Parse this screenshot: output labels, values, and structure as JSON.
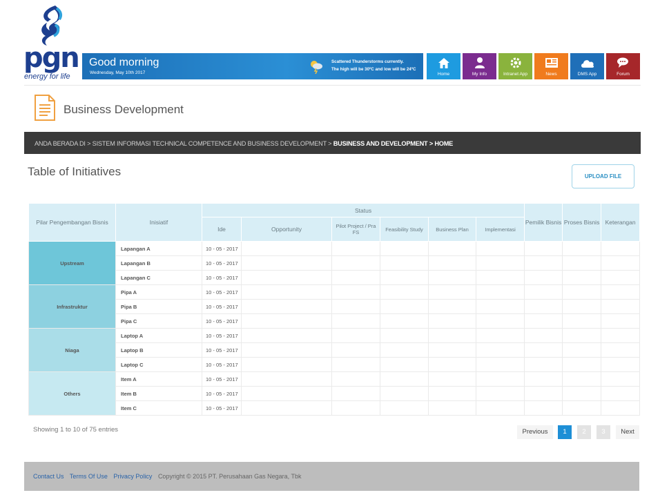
{
  "brand": {
    "wordmark": "pgn",
    "tagline": "energy for life"
  },
  "greeting": {
    "title": "Good morning",
    "date": "Wednesday, May 10th 2017",
    "weather_line1": "Scattered Thunderstorms currently.",
    "weather_line2": "The high will be 30ºC and low will be 24ºC"
  },
  "nav": [
    {
      "label": "Home",
      "color": "#1e9be0",
      "icon": "home-icon"
    },
    {
      "label": "My Info",
      "color": "#7b2c8f",
      "icon": "user-icon"
    },
    {
      "label": "Intranet App",
      "color": "#8ab33d",
      "icon": "gear-icon"
    },
    {
      "label": "News",
      "color": "#f07b1d",
      "icon": "news-icon"
    },
    {
      "label": "DMS App",
      "color": "#1f6fb8",
      "icon": "cloud-icon"
    },
    {
      "label": "Forum",
      "color": "#a6272a",
      "icon": "chat-icon"
    }
  ],
  "page_title": "Business Development",
  "breadcrumb": {
    "prefix": "ANDA BERADA DI > SISTEM INFORMASI TECHNICAL COMPETENCE AND BUSINESS DEVELOPMENT > ",
    "current": "BUSINESS AND DEVELOPMENT > HOME"
  },
  "section_title": "Table of Initiatives",
  "upload_label": "UPLOAD FILE",
  "table": {
    "headers": {
      "pilar": "Pilar Pengembangan Bisnis",
      "inisiatif": "Inisiatif",
      "status": "Status",
      "ide": "Ide",
      "opportunity": "Opportunity",
      "pilot": "Pilot Project / Pra FS",
      "feasibility": "Feasibility Study",
      "business_plan": "Business Plan",
      "implementasi": "Implementasi",
      "pemilik": "Pemilik Bisnis",
      "proses": "Proses Bisnis",
      "keterangan": "Keterangan"
    },
    "groups": [
      {
        "pillar": "Upstream",
        "color": "#6ec6d9",
        "rows": [
          {
            "inisiatif": "Lapangan A",
            "ide": "10 - 05 - 2017"
          },
          {
            "inisiatif": "Lapangan B",
            "ide": "10 - 05 - 2017"
          },
          {
            "inisiatif": "Lapangan C",
            "ide": "10 - 05 - 2017"
          }
        ]
      },
      {
        "pillar": "Infrastruktur",
        "color": "#8dd1e0",
        "rows": [
          {
            "inisiatif": "Pipa A",
            "ide": "10 - 05 - 2017"
          },
          {
            "inisiatif": "Pipa B",
            "ide": "10 - 05 - 2017"
          },
          {
            "inisiatif": "Pipa C",
            "ide": "10 - 05 - 2017"
          }
        ]
      },
      {
        "pillar": "Niaga",
        "color": "#aadde8",
        "rows": [
          {
            "inisiatif": "Laptop A",
            "ide": "10 - 05 - 2017"
          },
          {
            "inisiatif": "Laptop B",
            "ide": "10 - 05 - 2017"
          },
          {
            "inisiatif": "Laptop C",
            "ide": "10 - 05 - 2017"
          }
        ]
      },
      {
        "pillar": "Others",
        "color": "#c6e9f1",
        "rows": [
          {
            "inisiatif": "Item A",
            "ide": "10 - 05 - 2017"
          },
          {
            "inisiatif": "Item B",
            "ide": "10 - 05 - 2017"
          },
          {
            "inisiatif": "Item C",
            "ide": "10 - 05 - 2017"
          }
        ]
      }
    ]
  },
  "showing": "Showing 1 to 10 of 75 entries",
  "pagination": {
    "previous": "Previous",
    "pages": [
      "1",
      "2",
      "3"
    ],
    "active": "1",
    "next": "Next"
  },
  "footer": {
    "contact": "Contact Us",
    "terms": "Terms Of Use",
    "privacy": "Privacy Policy",
    "copyright": "Copyright © 2015 PT. Perusahaan Gas Negara, Tbk"
  }
}
